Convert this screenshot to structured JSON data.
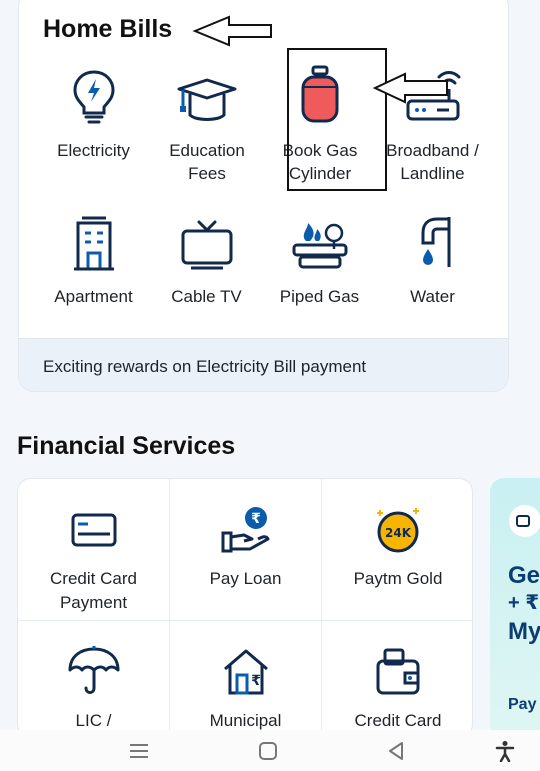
{
  "home_bills": {
    "title": "Home Bills",
    "items": [
      {
        "label": "Electricity",
        "icon": "bulb-icon"
      },
      {
        "label": "Education Fees",
        "icon": "graduation-cap-icon"
      },
      {
        "label": "Book Gas Cylinder",
        "icon": "gas-cylinder-icon"
      },
      {
        "label": "Broadband / Landline",
        "icon": "router-icon"
      },
      {
        "label": "Apartment",
        "icon": "building-icon"
      },
      {
        "label": "Cable TV",
        "icon": "tv-icon"
      },
      {
        "label": "Piped Gas",
        "icon": "piped-gas-icon"
      },
      {
        "label": "Water",
        "icon": "water-tap-icon"
      }
    ],
    "rewards_text": "Exciting rewards on Electricity Bill payment"
  },
  "financial_services": {
    "title": "Financial Services",
    "items": [
      {
        "label": "Credit Card Payment",
        "icon": "credit-card-icon"
      },
      {
        "label": "Pay Loan",
        "icon": "loan-hand-icon"
      },
      {
        "label": "Paytm Gold",
        "icon": "gold-coin-icon",
        "badge": "24K"
      },
      {
        "label": "LIC /",
        "icon": "umbrella-icon"
      },
      {
        "label": "Municipal",
        "icon": "house-rupee-icon"
      },
      {
        "label": "Credit Card",
        "icon": "wallet-icon"
      }
    ]
  },
  "promo": {
    "line1": "Ge",
    "line2": "+ ₹",
    "line3": "My",
    "footer": "Pay"
  },
  "colors": {
    "accent_blue": "#0b5cad",
    "icon_navy": "#10294d",
    "gas_red": "#ef5b5b",
    "gold": "#f7b500"
  }
}
